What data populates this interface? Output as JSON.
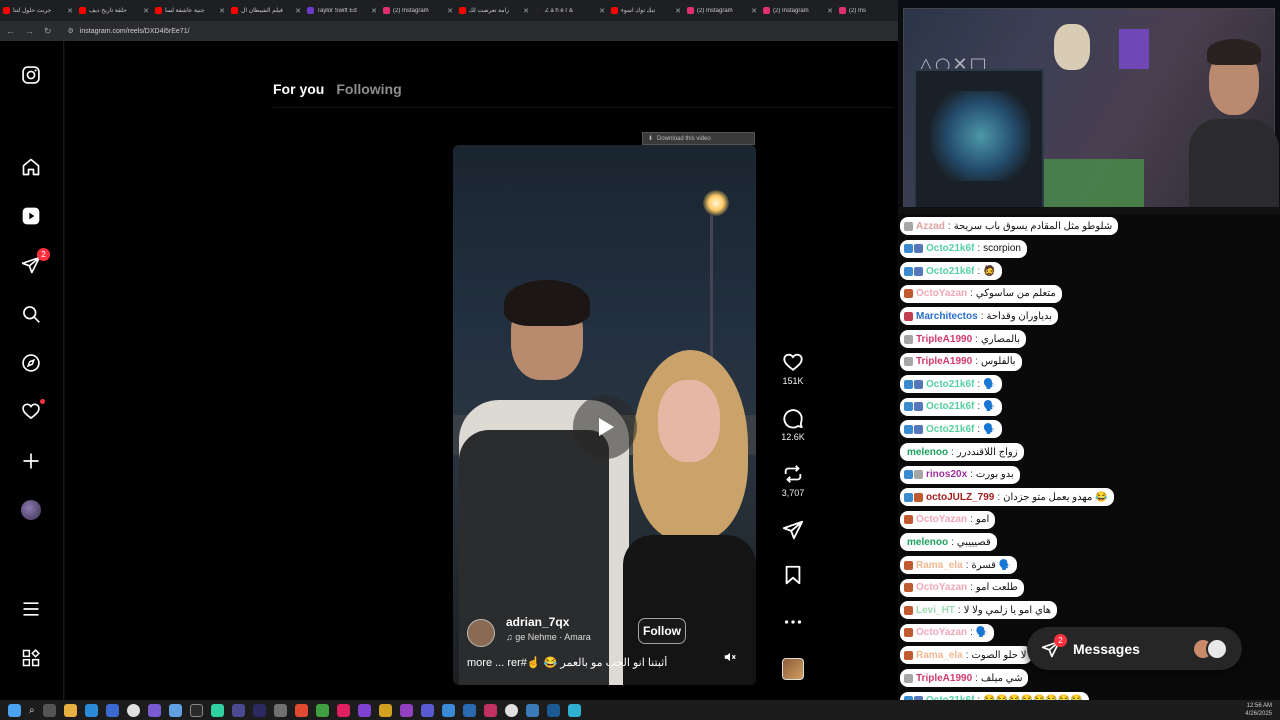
{
  "browser": {
    "tabs": [
      {
        "title": "جربت حلول لتنا",
        "color": "#ff0000"
      },
      {
        "title": "حلقة تاريخ ديف",
        "color": "#ff0000"
      },
      {
        "title": "جنية عاشقة لسا",
        "color": "#ff0000"
      },
      {
        "title": "فيلم الشيطان ال",
        "color": "#ff0000"
      },
      {
        "title": "Taylor Swift Ed",
        "color": "#6a3ac8"
      },
      {
        "title": "(2) Instagram",
        "color": "#e1306c"
      },
      {
        "title": "رامة تعرضت لك",
        "color": "#ff0000"
      },
      {
        "title": "Z a h e r &",
        "color": "#222222"
      },
      {
        "title": "تيك توك اسوء",
        "color": "#ff0000"
      },
      {
        "title": "(2) Instagram",
        "color": "#e1306c"
      },
      {
        "title": "(2) Instagram",
        "color": "#e1306c"
      },
      {
        "title": "(2) Ins",
        "color": "#e1306c"
      }
    ],
    "url": "instagram.com/reels/DXD4i5rEe71/"
  },
  "sidebar": {
    "notifications_badge": "2"
  },
  "feed": {
    "tab_for_you": "For you",
    "tab_following": "Following"
  },
  "download_overlay": "Download this video",
  "reel": {
    "author": "adrian_7qx",
    "audio": "ge Nehme · Amara",
    "follow": "Follow",
    "caption": "more ... rer#☝️ 😂 أثبتنا انو الحب مو بالعمر"
  },
  "actions": {
    "likes": "151K",
    "comments": "12.6K",
    "reposts": "3,707"
  },
  "webcam": {
    "logo": "△○✕□"
  },
  "chat": [
    {
      "user": "Azzad",
      "ucolor": "#e0a0a0",
      "text": "شلوطو مثل المقادم يسوق باب سريحة",
      "icons": [
        "#a6a6a6"
      ]
    },
    {
      "user": "Octo21k6f",
      "ucolor": "#56d0a0",
      "text": "scorpion",
      "icons": [
        "#3a8ad0",
        "#5577bb"
      ]
    },
    {
      "user": "Octo21k6f",
      "ucolor": "#56d0a0",
      "text": "🧔",
      "icons": [
        "#3a8ad0",
        "#5577bb"
      ]
    },
    {
      "user": "OctoYazan",
      "ucolor": "#f0a8b8",
      "text": "متعلم من ساسوكي",
      "icons": [
        "#c05a30"
      ]
    },
    {
      "user": "Marchitectos",
      "ucolor": "#2a6fd0",
      "text": "بدياوران وقداحة",
      "icons": [
        "#c04050"
      ]
    },
    {
      "user": "TripleA1990",
      "ucolor": "#d03a6a",
      "text": "بالمصاري",
      "icons": [
        "#a6a6a6"
      ]
    },
    {
      "user": "TripleA1990",
      "ucolor": "#d03a6a",
      "text": "بالفلوس",
      "icons": [
        "#a6a6a6"
      ]
    },
    {
      "user": "Octo21k6f",
      "ucolor": "#56d0a0",
      "text": "🗣️",
      "icons": [
        "#3a8ad0",
        "#5577bb"
      ]
    },
    {
      "user": "Octo21k6f",
      "ucolor": "#56d0a0",
      "text": "🗣️",
      "icons": [
        "#3a8ad0",
        "#5577bb"
      ]
    },
    {
      "user": "Octo21k6f",
      "ucolor": "#56d0a0",
      "text": "🗣️",
      "icons": [
        "#3a8ad0",
        "#5577bb"
      ]
    },
    {
      "user": "melenoo",
      "ucolor": "#20a060",
      "text": "زواج اللاقنددرر",
      "icons": []
    },
    {
      "user": "rinos20x",
      "ucolor": "#a030a0",
      "text": "بدو بورت",
      "icons": [
        "#3a8ad0",
        "#a6a6a6"
      ]
    },
    {
      "user": "octoJULZ_799",
      "ucolor": "#a02020",
      "text": "مهدو يعمل متو جزدان 😂",
      "icons": [
        "#3a8ad0",
        "#c05a30"
      ]
    },
    {
      "user": "OctoYazan",
      "ucolor": "#f0a8b8",
      "text": "امو",
      "icons": [
        "#c05a30"
      ]
    },
    {
      "user": "melenoo",
      "ucolor": "#20a060",
      "text": "قصيييبي",
      "icons": []
    },
    {
      "user": "Rama_ela",
      "ucolor": "#f0b890",
      "text": "قسرة 🗣️",
      "icons": [
        "#c05a30"
      ]
    },
    {
      "user": "OctoYazan",
      "ucolor": "#f0a8b8",
      "text": "طلعت امو",
      "icons": [
        "#c05a30"
      ]
    },
    {
      "user": "Levi_HT",
      "ucolor": "#a0d8b0",
      "text": "هاي امو يا زلمي ولا لا",
      "icons": [
        "#c05a30"
      ]
    },
    {
      "user": "OctoYazan",
      "ucolor": "#f0a8b8",
      "text": "🗣️",
      "icons": [
        "#c05a30"
      ]
    },
    {
      "user": "Rama_ela",
      "ucolor": "#f0b890",
      "text": "لا حلو الصوت",
      "icons": [
        "#c05a30"
      ]
    },
    {
      "user": "TripleA1990",
      "ucolor": "#d03a6a",
      "text": "شي ميلف",
      "icons": [
        "#a6a6a6"
      ]
    },
    {
      "user": "Octo21k6f",
      "ucolor": "#56d0a0",
      "text": "😂😂😂😂😂😂😂😂",
      "icons": [
        "#3a8ad0",
        "#5577bb"
      ]
    },
    {
      "user": "TripleA1990",
      "ucolor": "#d03a6a",
      "text": "...",
      "icons": [
        "#a6a6a6"
      ]
    }
  ],
  "messages_pill": {
    "label": "Messages",
    "badge": "2"
  },
  "taskbar": {
    "time": "12:56 AM",
    "date": "4/26/2025"
  }
}
